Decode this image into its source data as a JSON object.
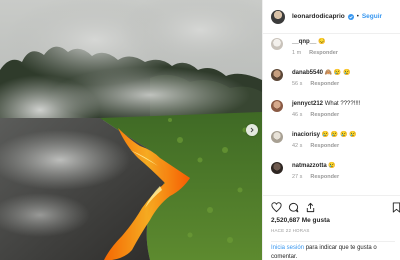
{
  "header": {
    "username": "leonardodicaprio",
    "separator": "•",
    "follow_label": "Seguir"
  },
  "comments": [
    {
      "username": "__qnp__",
      "emoji": "😔",
      "time": "1 m",
      "reply_label": "Responder"
    },
    {
      "username": "danab5540",
      "emoji": "🙈 😢 😢",
      "time": "56 s",
      "reply_label": "Responder"
    },
    {
      "username": "jennyct212",
      "emoji": "What ????!!!!",
      "time": "46 s",
      "reply_label": "Responder"
    },
    {
      "username": "inaciorisy",
      "emoji": "😢 😢 😢 😢",
      "time": "42 s",
      "reply_label": "Responder"
    },
    {
      "username": "natmazzotta",
      "emoji": "😢",
      "time": "27 s",
      "reply_label": "Responder"
    }
  ],
  "post": {
    "likes": "2,520,687 Me gusta",
    "time_ago": "HACE 22 HORAS"
  },
  "login_prompt": {
    "link": "Inicia sesión",
    "rest": " para indicar que te gusta o comentar."
  },
  "icons": {
    "verified": "verified-badge-icon",
    "like": "heart-icon",
    "comment": "comment-bubble-icon",
    "share": "share-icon",
    "save": "bookmark-icon",
    "next": "chevron-right-icon"
  },
  "colors": {
    "link_blue": "#3897f0",
    "muted": "#999999",
    "text": "#262626"
  }
}
